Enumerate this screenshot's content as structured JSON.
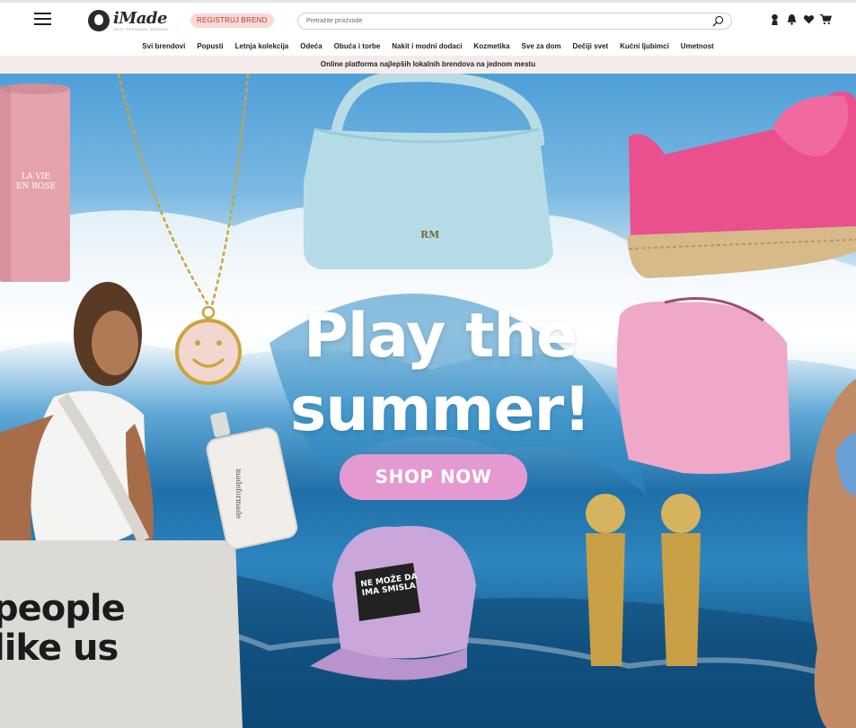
{
  "header": {
    "logo_text": "iMade",
    "logo_tagline": "VERY PERSONAL BRANDS",
    "register_label": "REGISTRUJ BREND",
    "search_placeholder": "Pretražite proizvode",
    "icons": [
      "user-icon",
      "bell-icon",
      "heart-icon",
      "cart-icon"
    ]
  },
  "nav": {
    "items": [
      "Svi brendovi",
      "Popusti",
      "Letnja kolekcija",
      "Odeća",
      "Obuća i torbe",
      "Nakit i modni dodaci",
      "Kozmetika",
      "Sve za dom",
      "Dečiji svet",
      "Kućni ljubimci",
      "Umetnost"
    ]
  },
  "info_strip": "Online platforma najlepših lokalnih brendova na jednom mestu",
  "hero": {
    "title_line1": "Play the",
    "title_line2": "summer!",
    "cta_label": "SHOP NOW",
    "tin_label_line1": "LA VIE",
    "tin_label_line2": "EN ROSE",
    "bag_text_line1": "people",
    "bag_text_line2": "like us",
    "handbag_monogram": "RM",
    "bottle_label": "madeformade",
    "cap_text_line1": "NE MOŽE DA",
    "cap_text_line2": "IMA SMISLA"
  },
  "colors": {
    "accent_pink": "#e49ad0",
    "register_bg": "#f9d9d6",
    "register_text": "#b23b35",
    "strip_bg": "#f4ecea"
  }
}
